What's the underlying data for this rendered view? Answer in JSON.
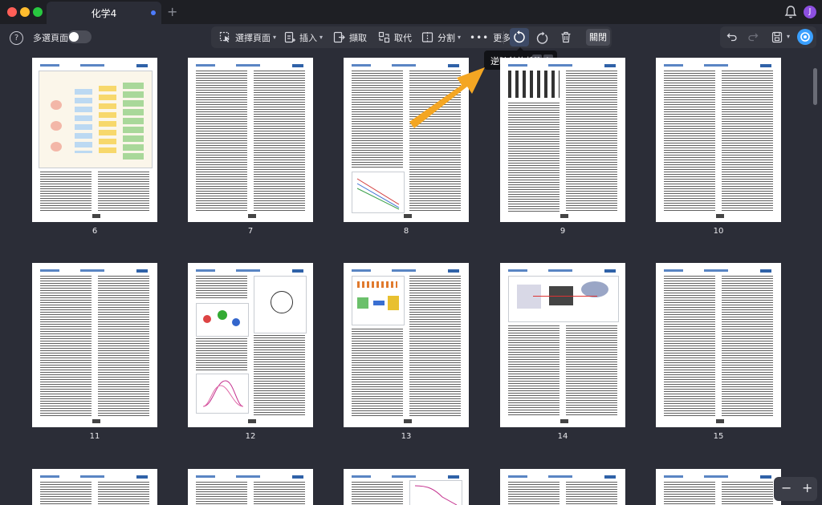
{
  "tab": {
    "title": "化学4"
  },
  "profile": {
    "initial": "J"
  },
  "toolbar_left": {
    "multi_select_label": "多選頁面",
    "multi_select_on": false
  },
  "toolbar": {
    "select_pages": "選擇頁面",
    "insert": "插入",
    "extract": "擷取",
    "replace": "取代",
    "split": "分割",
    "more": "更多",
    "close": "關閉"
  },
  "tooltip": {
    "text": "逆時針旋轉",
    "key1": "⌘",
    "key2": "L"
  },
  "pages": [
    {
      "number": "6"
    },
    {
      "number": "7"
    },
    {
      "number": "8"
    },
    {
      "number": "9"
    },
    {
      "number": "10"
    },
    {
      "number": "11"
    },
    {
      "number": "12"
    },
    {
      "number": "13"
    },
    {
      "number": "14"
    },
    {
      "number": "15"
    }
  ],
  "zoom": {
    "minus": "−",
    "plus": "+"
  },
  "colors": {
    "accent": "#4d7cff",
    "annotation_arrow": "#f4a623",
    "background": "#2b2d37"
  }
}
